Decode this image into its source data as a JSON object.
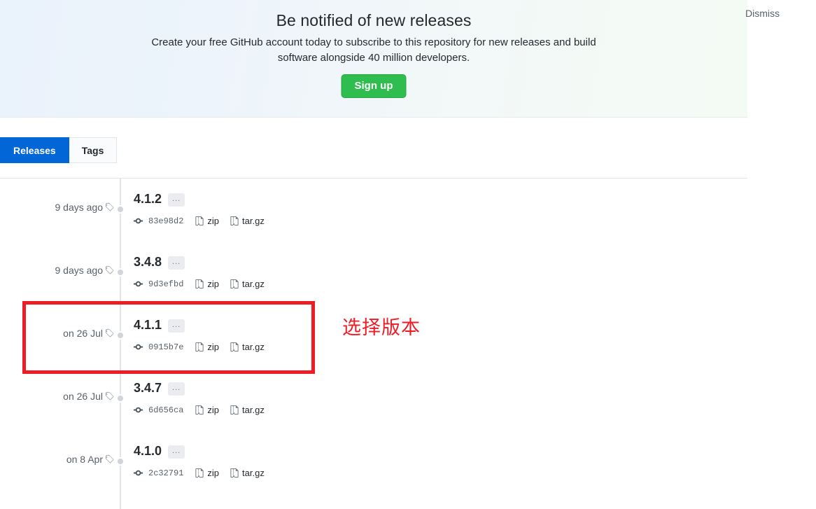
{
  "banner": {
    "title": "Be notified of new releases",
    "subtitle": "Create your free GitHub account today to subscribe to this repository for new releases and build software alongside 40 million developers.",
    "signup_label": "Sign up",
    "dismiss_label": "Dismiss",
    "accent_green": "#2ebd4e"
  },
  "tabs": [
    {
      "label": "Releases",
      "active": true
    },
    {
      "label": "Tags",
      "active": false
    }
  ],
  "tab_active_color": "#0366d6",
  "releases": [
    {
      "version": "4.1.2",
      "date": "9 days ago",
      "sha": "83e98d2",
      "more_label": "...",
      "assets": [
        {
          "label": "zip"
        },
        {
          "label": "tar.gz"
        }
      ]
    },
    {
      "version": "3.4.8",
      "date": "9 days ago",
      "sha": "9d3efbd",
      "more_label": "...",
      "assets": [
        {
          "label": "zip"
        },
        {
          "label": "tar.gz"
        }
      ]
    },
    {
      "version": "4.1.1",
      "date": "on 26 Jul",
      "sha": "0915b7e",
      "more_label": "...",
      "assets": [
        {
          "label": "zip"
        },
        {
          "label": "tar.gz"
        }
      ]
    },
    {
      "version": "3.4.7",
      "date": "on 26 Jul",
      "sha": "6d656ca",
      "more_label": "...",
      "assets": [
        {
          "label": "zip"
        },
        {
          "label": "tar.gz"
        }
      ]
    },
    {
      "version": "4.1.0",
      "date": "on 8 Apr",
      "sha": "2c32791",
      "more_label": "...",
      "assets": [
        {
          "label": "zip"
        },
        {
          "label": "tar.gz"
        }
      ]
    }
  ],
  "annotation": {
    "text": "选择版本",
    "color": "#ee1c25"
  },
  "icons": {
    "tag": "tag-icon",
    "commit": "git-commit-icon",
    "file_zip": "file-zip-icon"
  }
}
